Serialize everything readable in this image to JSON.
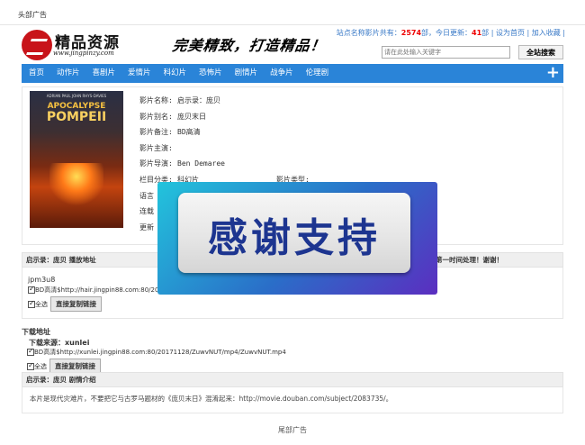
{
  "top_ad": "头部广告",
  "logo": {
    "name": "精品资源",
    "url": "www.jingpinzy.com"
  },
  "slogan": "完美精致，打造精品！",
  "stats": {
    "prefix": "站点名称影片共有：",
    "total": "2574",
    "mid": "部，今日更新：",
    "today": "41",
    "suffix": "部 |",
    "set_home": "设为首页",
    "sep": "|",
    "add_fav": "加入收藏",
    "end": "|"
  },
  "search": {
    "placeholder": "请在此处输入关键字",
    "button": "全站搜索"
  },
  "nav": [
    "首页",
    "动作片",
    "喜剧片",
    "爱情片",
    "科幻片",
    "恐怖片",
    "剧情片",
    "战争片",
    "伦理剧"
  ],
  "poster": {
    "actors": "ADRIAN PAUL   JOHN RHYS-DAVIES",
    "title1": "APOCALYPSE",
    "title2": "POMPEII"
  },
  "movie": {
    "name_label": "影片名称:",
    "name": "启示录：庞贝",
    "alias_label": "影片别名:",
    "alias": "庞贝末日",
    "note_label": "影片备注:",
    "note": "BD高清",
    "actors_label": "影片主演:",
    "actors": "",
    "director_label": "影片导演:",
    "director": "Ben Demaree",
    "category_label": "栏目分类:",
    "category": "科幻片",
    "type_label": "影片类型:",
    "type": "",
    "language_label": "语言",
    "serial_label": "连载",
    "update_label": "更新"
  },
  "play": {
    "header": "启示录：庞贝  播放地址",
    "header_right": "第一时间处理！谢谢！",
    "source": "jpm3u8",
    "link": "BD高清$http://hair.jingpin88.com:80/20",
    "select_all": "全选",
    "copy_button": "直接复制链接"
  },
  "download": {
    "title": "下载地址",
    "source": "下载来源：xunlei",
    "link": "BD高清$http://xunlei.jingpin88.com:80/20171128/ZuwvNUT/mp4/ZuwvNUT.mp4",
    "select_all": "全选",
    "copy_button": "直接复制链接"
  },
  "plot": {
    "header": "启示录：庞贝  剧情介绍",
    "text": "本片是现代灾难片，不要把它与古罗马题材的《庞贝末日》混淆起来：http://movie.douban.com/subject/2083735/。"
  },
  "foot_ad": "尾部广告",
  "overlay": {
    "text": "感谢支持"
  }
}
